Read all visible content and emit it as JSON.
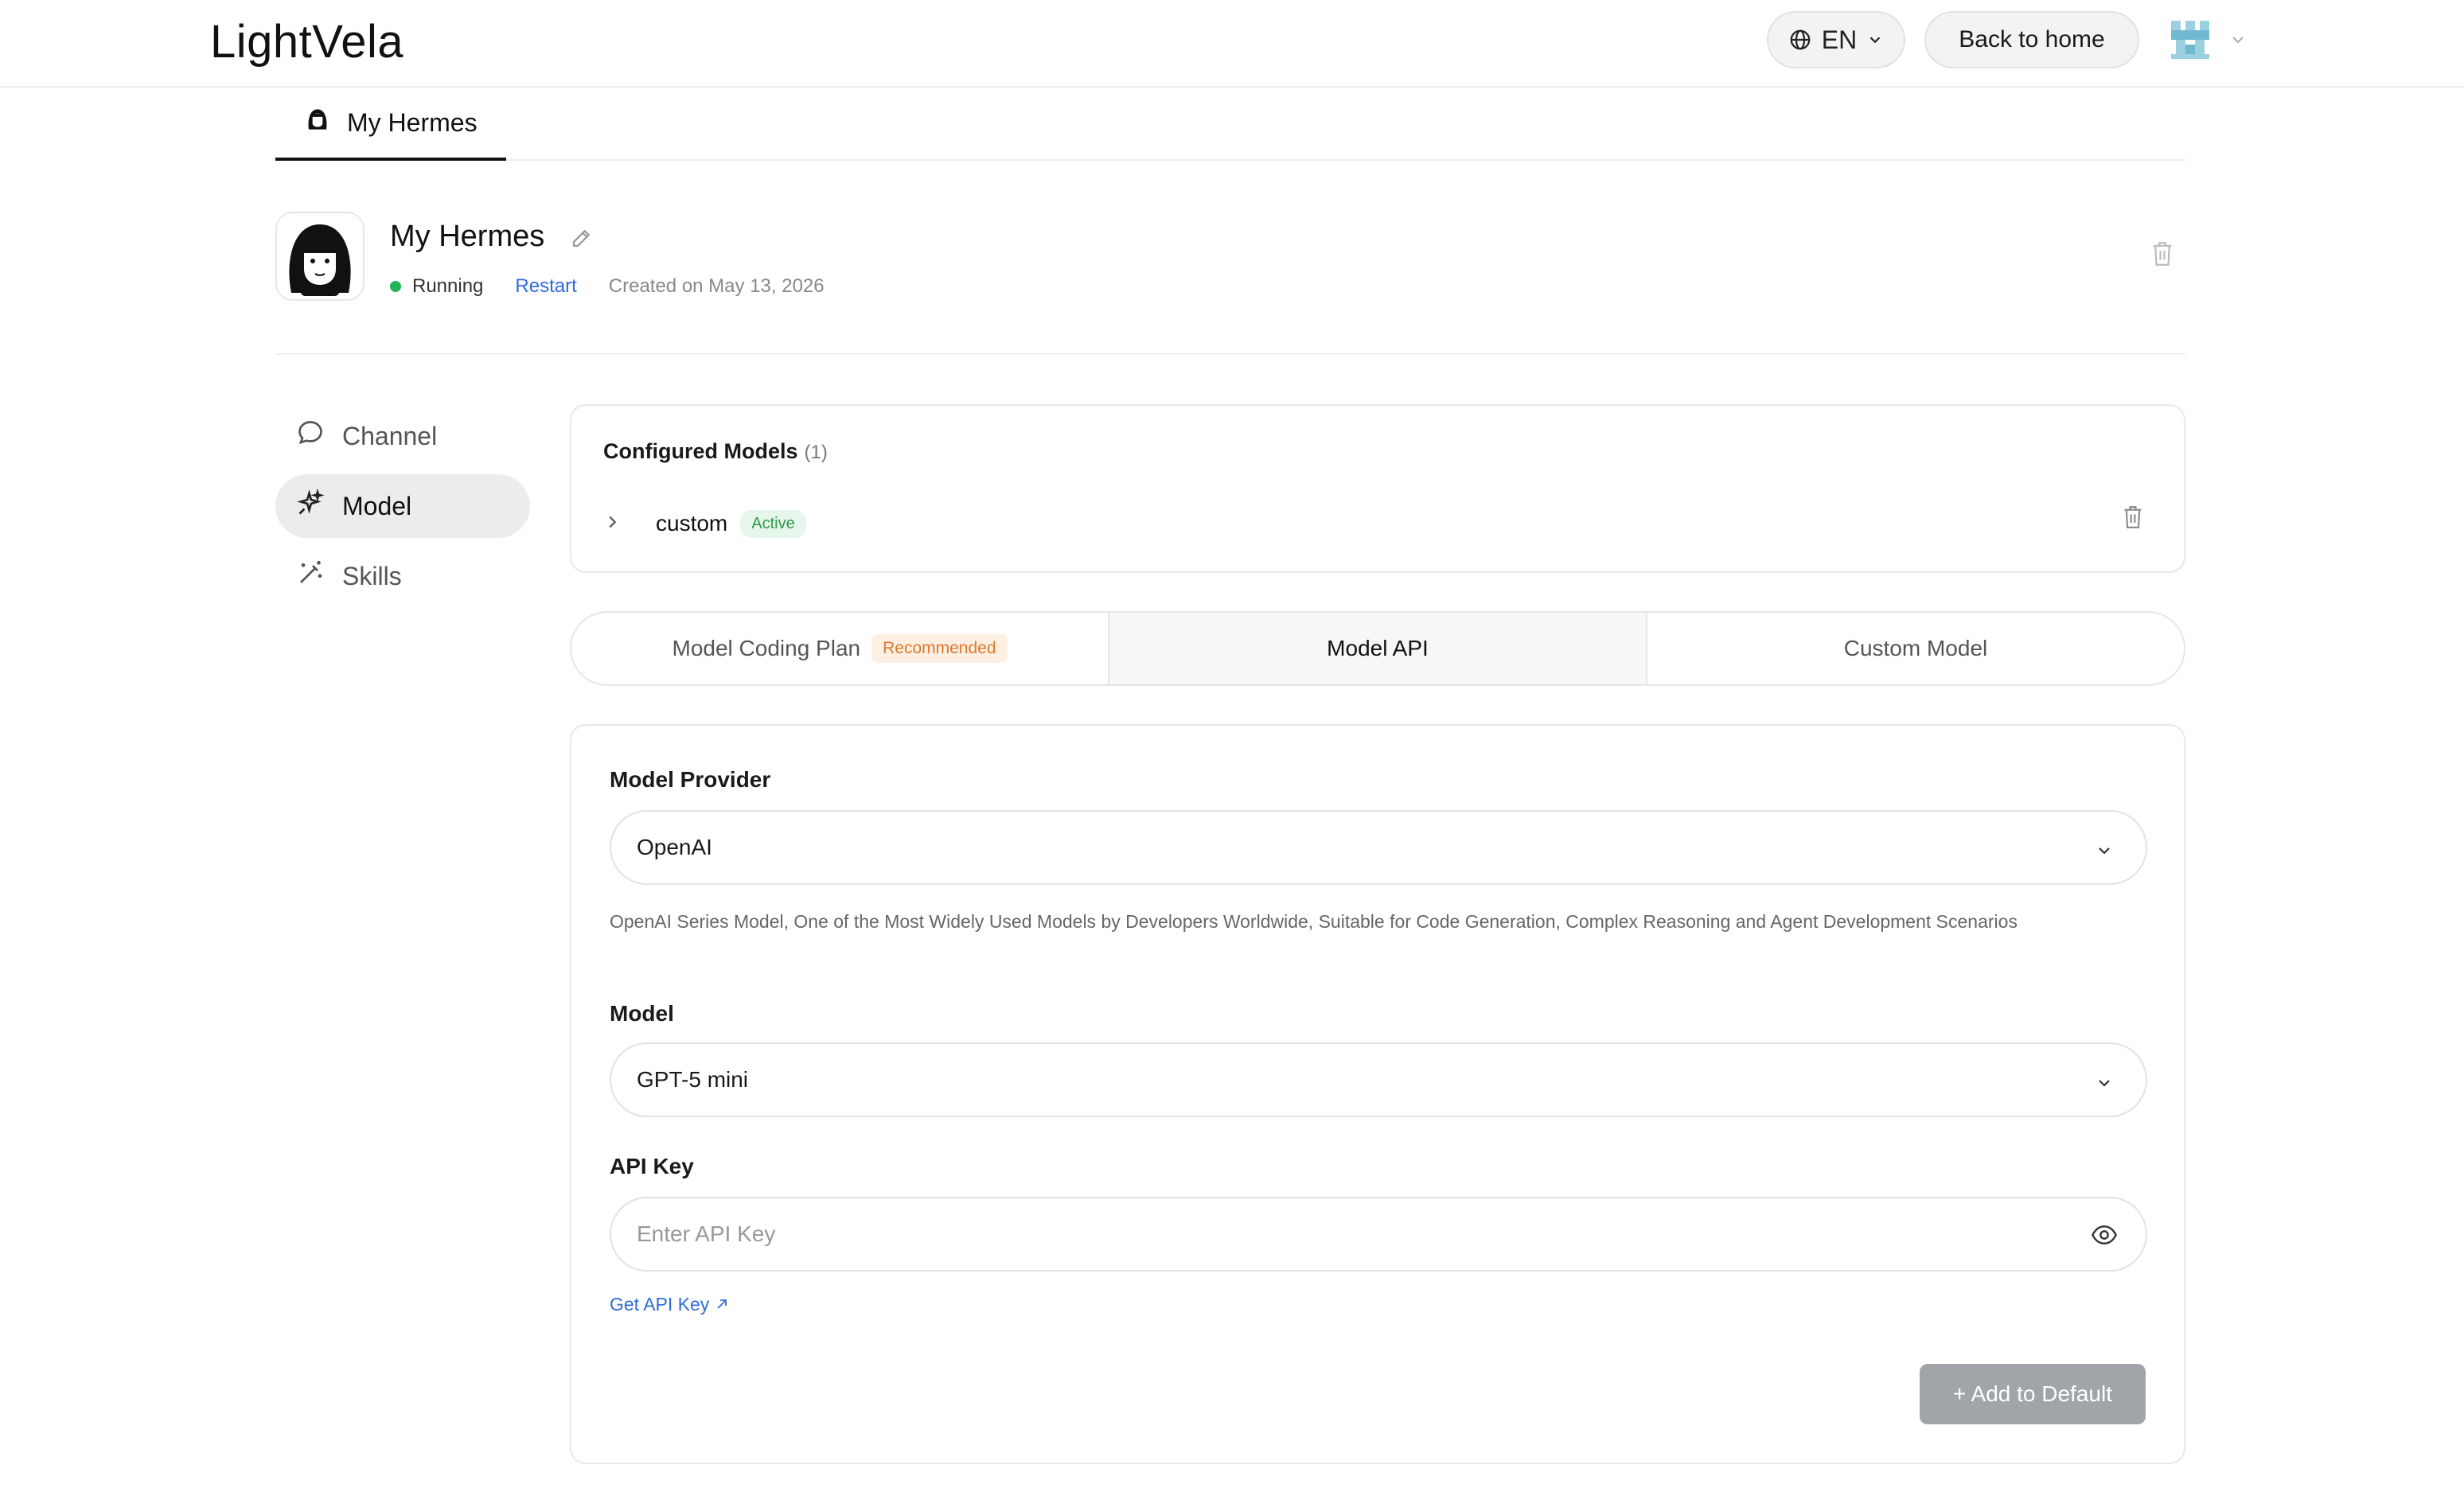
{
  "header": {
    "brand": "LightVela",
    "language": "EN",
    "back_home": "Back to home"
  },
  "agent_tab": {
    "label": "My Hermes"
  },
  "agent": {
    "name": "My Hermes",
    "status": "Running",
    "restart": "Restart",
    "created": "Created on May 13, 2026",
    "status_color": "#22b455"
  },
  "sidebar": {
    "items": [
      {
        "label": "Channel",
        "icon": "chat-bubble-icon"
      },
      {
        "label": "Model",
        "icon": "sparkle-icon"
      },
      {
        "label": "Skills",
        "icon": "magic-wand-icon"
      }
    ]
  },
  "configured": {
    "title": "Configured Models",
    "count": "(1)",
    "models": [
      {
        "name": "custom",
        "badge": "Active"
      }
    ]
  },
  "tabs": [
    {
      "label": "Model Coding Plan",
      "badge": "Recommended"
    },
    {
      "label": "Model API"
    },
    {
      "label": "Custom Model"
    }
  ],
  "form": {
    "provider_label": "Model Provider",
    "provider_value": "OpenAI",
    "provider_desc": "OpenAI Series Model, One of the Most Widely Used Models by Developers Worldwide, Suitable for Code Generation, Complex Reasoning and Agent Development Scenarios",
    "model_label": "Model",
    "model_value": "GPT-5 mini",
    "apikey_label": "API Key",
    "apikey_placeholder": "Enter API Key",
    "get_key_link": "Get API Key",
    "add_button": "+ Add to Default"
  },
  "colors": {
    "link": "#2f6bdc",
    "active_badge_bg": "#e6f6ea",
    "recommended_badge_text": "#e0772a",
    "add_button_bg": "#a1a5aa"
  }
}
